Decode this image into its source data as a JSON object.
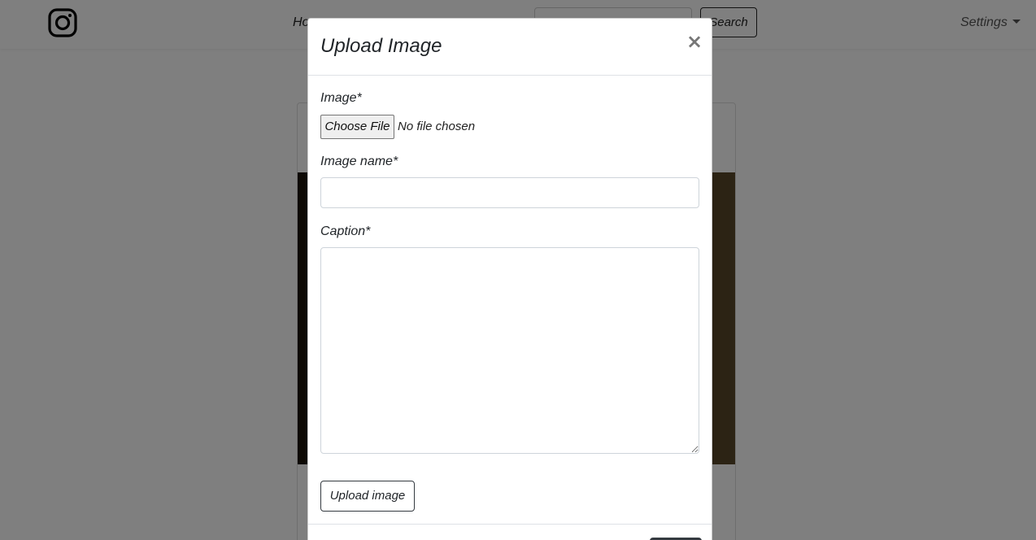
{
  "navbar": {
    "logo_icon": "instagram-icon",
    "home_label": "Ho",
    "search_button_label": "Search",
    "settings_label": "Settings"
  },
  "modal": {
    "title": "Upload Image",
    "close_label": "×",
    "image_label": "Image*",
    "file_button_label": "Choose File",
    "file_status": "No file chosen",
    "image_name_label": "Image name*",
    "image_name_value": "",
    "caption_label": "Caption*",
    "caption_value": "",
    "upload_button_label": "Upload image"
  }
}
